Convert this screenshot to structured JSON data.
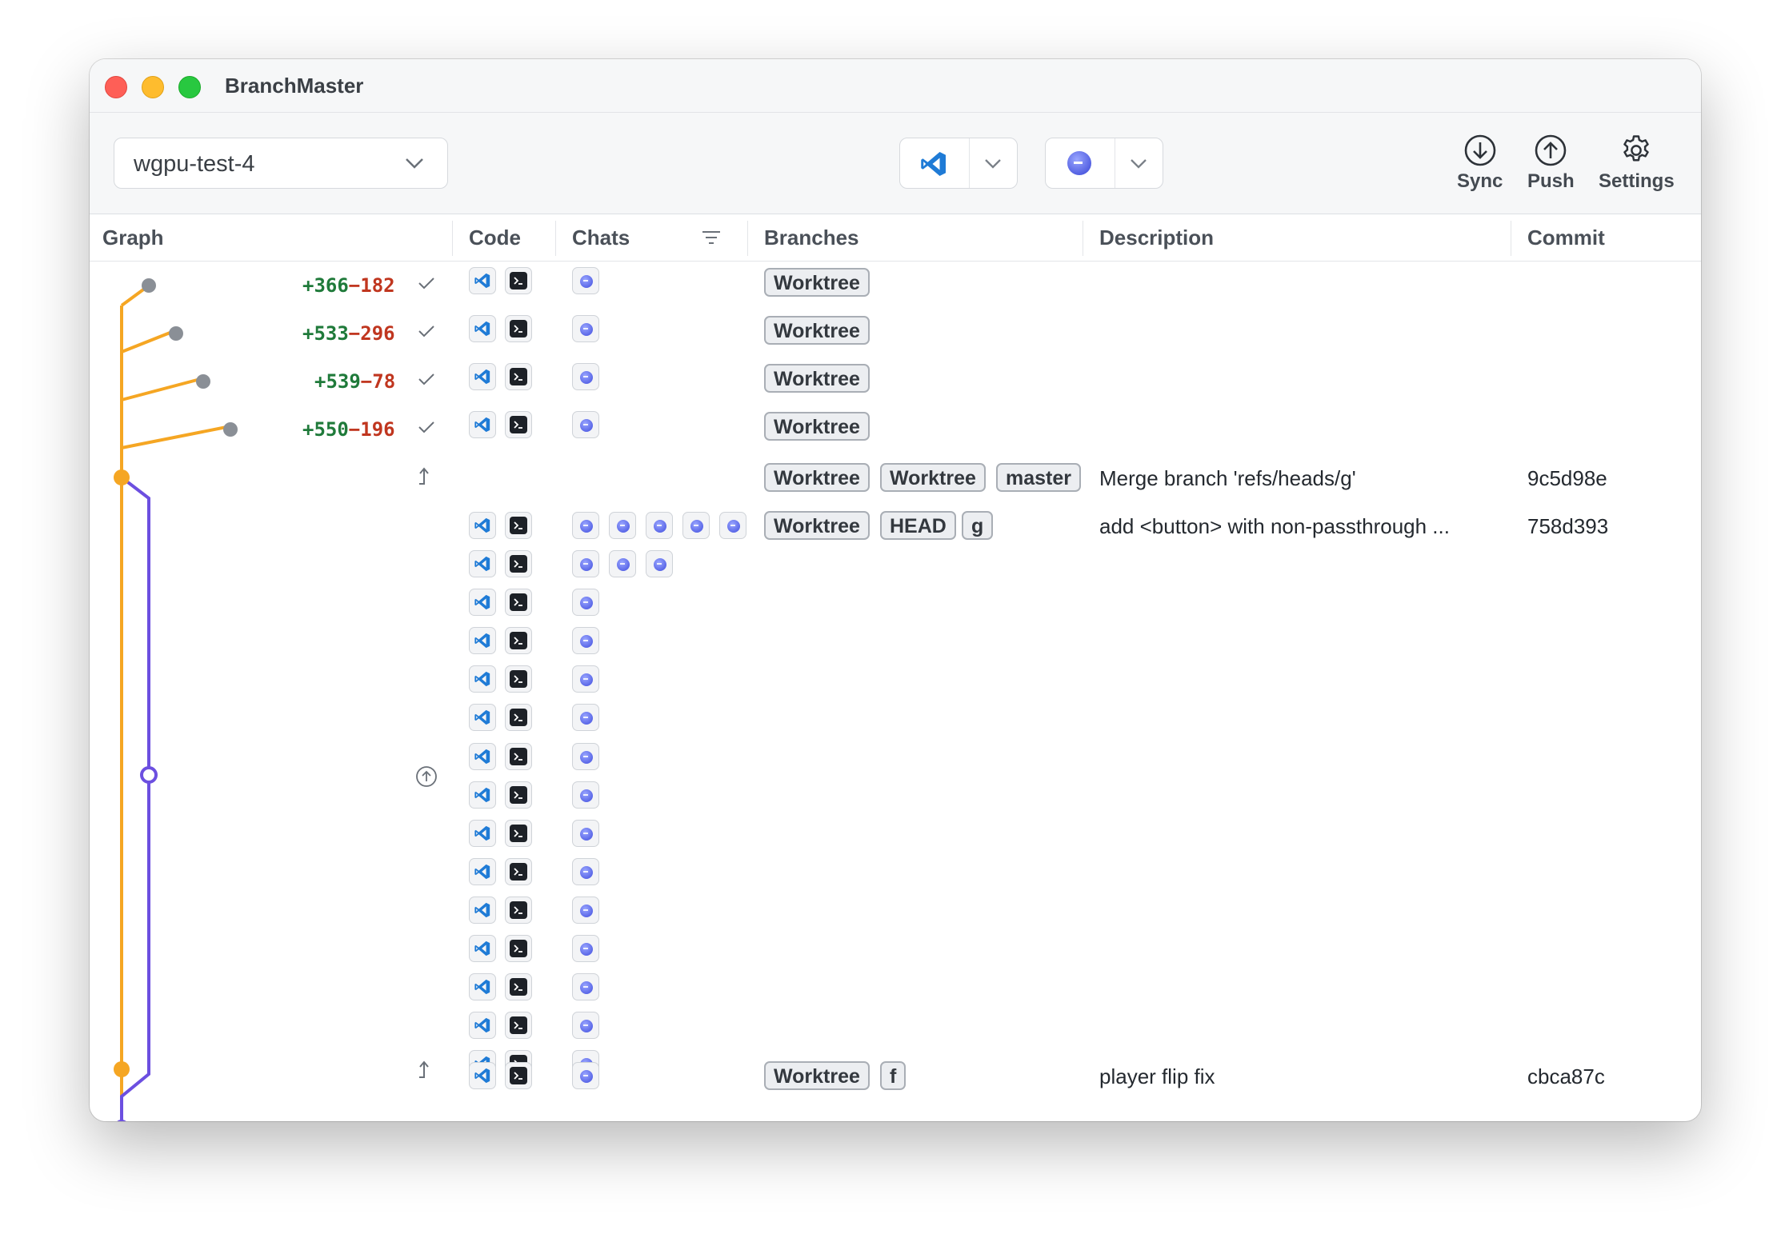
{
  "app": {
    "title": "BranchMaster"
  },
  "toolbar": {
    "repo": "wgpu-test-4",
    "sync_label": "Sync",
    "push_label": "Push",
    "settings_label": "Settings"
  },
  "columns": {
    "graph": "Graph",
    "code": "Code",
    "chats": "Chats",
    "branches": "Branches",
    "description": "Description",
    "commit": "Commit"
  },
  "worktree_rows": [
    {
      "plus": "+366",
      "minus": "−182",
      "tag": "Worktree"
    },
    {
      "plus": "+533",
      "minus": "−296",
      "tag": "Worktree"
    },
    {
      "plus": "+539",
      "minus": "−78",
      "tag": "Worktree"
    },
    {
      "plus": "+550",
      "minus": "−196",
      "tag": "Worktree"
    }
  ],
  "commit_rows": [
    {
      "tags": [
        "Worktree",
        "Worktree",
        "master"
      ],
      "description": "Merge branch 'refs/heads/g'",
      "commit": "9c5d98e"
    },
    {
      "tags": [
        "Worktree",
        "HEAD",
        "g"
      ],
      "description": "add <button> with non-passthrough ...",
      "commit": "758d393"
    },
    {
      "tags": [
        "Worktree",
        "f"
      ],
      "description": "player flip fix",
      "commit": "cbca87c"
    }
  ],
  "colors": {
    "main_branch": "#f5a623",
    "feature_branch": "#6c4fe0",
    "worktree_node": "#8a8f96",
    "vscode": "#1f7bd6",
    "terminal": "#1d2127",
    "additions": "#1f7a3a",
    "deletions": "#c0361f"
  },
  "icons": {
    "editor": "vscode-icon",
    "terminal": "terminal-icon",
    "chat": "ai-chat-icon",
    "sync": "arrow-down-circle-icon",
    "push": "arrow-up-circle-icon",
    "settings": "gear-icon",
    "filter": "filter-icon",
    "check": "check-icon"
  }
}
